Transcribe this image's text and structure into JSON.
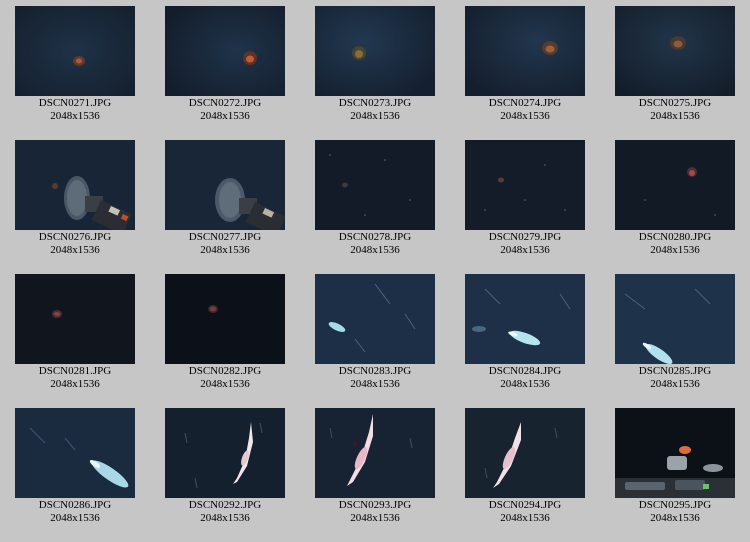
{
  "gallery": {
    "items": [
      {
        "filename": "DSCN0271.JPG",
        "dimensions": "2048x1536",
        "subject": "jellyfish"
      },
      {
        "filename": "DSCN0272.JPG",
        "dimensions": "2048x1536",
        "subject": "jellyfish"
      },
      {
        "filename": "DSCN0273.JPG",
        "dimensions": "2048x1536",
        "subject": "jellyfish"
      },
      {
        "filename": "DSCN0274.JPG",
        "dimensions": "2048x1536",
        "subject": "jellyfish"
      },
      {
        "filename": "DSCN0275.JPG",
        "dimensions": "2048x1536",
        "subject": "jellyfish"
      },
      {
        "filename": "DSCN0276.JPG",
        "dimensions": "2048x1536",
        "subject": "sampler"
      },
      {
        "filename": "DSCN0277.JPG",
        "dimensions": "2048x1536",
        "subject": "sampler"
      },
      {
        "filename": "DSCN0278.JPG",
        "dimensions": "2048x1536",
        "subject": "particles"
      },
      {
        "filename": "DSCN0279.JPG",
        "dimensions": "2048x1536",
        "subject": "particles"
      },
      {
        "filename": "DSCN0280.JPG",
        "dimensions": "2048x1536",
        "subject": "jellyfish"
      },
      {
        "filename": "DSCN0281.JPG",
        "dimensions": "2048x1536",
        "subject": "jellyfish"
      },
      {
        "filename": "DSCN0282.JPG",
        "dimensions": "2048x1536",
        "subject": "jellyfish"
      },
      {
        "filename": "DSCN0283.JPG",
        "dimensions": "2048x1536",
        "subject": "squid"
      },
      {
        "filename": "DSCN0284.JPG",
        "dimensions": "2048x1536",
        "subject": "squid"
      },
      {
        "filename": "DSCN0285.JPG",
        "dimensions": "2048x1536",
        "subject": "squid"
      },
      {
        "filename": "DSCN0286.JPG",
        "dimensions": "2048x1536",
        "subject": "squid"
      },
      {
        "filename": "DSCN0292.JPG",
        "dimensions": "2048x1536",
        "subject": "squid"
      },
      {
        "filename": "DSCN0293.JPG",
        "dimensions": "2048x1536",
        "subject": "squid"
      },
      {
        "filename": "DSCN0294.JPG",
        "dimensions": "2048x1536",
        "subject": "squid"
      },
      {
        "filename": "DSCN0295.JPG",
        "dimensions": "2048x1536",
        "subject": "robot-arm"
      }
    ]
  },
  "colors": {
    "page_background": "#c6c6c6",
    "water_dark": "#111a26",
    "water_blue": "#1c2f48",
    "squid_white": "#f0e6ea"
  }
}
